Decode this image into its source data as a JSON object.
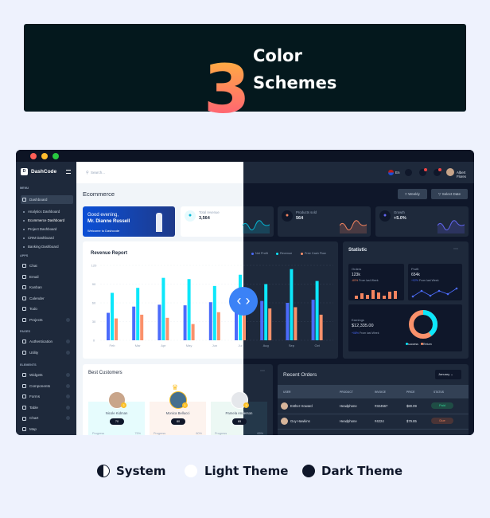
{
  "banner": {
    "number": "3",
    "line1": "Color",
    "line2": "Schemes"
  },
  "window": {
    "dots": [
      "#ff5f57",
      "#febc2e",
      "#28c840"
    ]
  },
  "sidebar": {
    "brand": "DashCode",
    "logo": "D",
    "sections": {
      "menu": "MENU",
      "apps": "APPS",
      "pages": "PAGES",
      "elements": "ELEMENTS"
    },
    "dashboard": "Dashboard",
    "sub_items": [
      "Analytics Dashboard",
      "Ecommerce Dashboard",
      "Project Dashboard",
      "CRM Dashboard",
      "Banking Dashboard"
    ],
    "apps": [
      "Chat",
      "Email",
      "Kanban",
      "Calender",
      "Todo",
      "Projects"
    ],
    "pages": [
      "Authentication",
      "Utility"
    ],
    "elements": [
      "Widgets",
      "Components",
      "Forms",
      "Table",
      "Chart",
      "Map"
    ]
  },
  "header": {
    "search_placeholder": "Search...",
    "language": "En",
    "user": "Albert Flores"
  },
  "page": {
    "title": "Ecommerce",
    "weekly": "Weekly",
    "select_date": "Select Date"
  },
  "greeting": {
    "line1": "Good evening,",
    "line2": "Mr. Dianne Russell",
    "line3": "Welcome to Dashcode"
  },
  "stats": [
    {
      "label": "Total revenue",
      "value": "3,564",
      "color": "#06b6d4"
    },
    {
      "label": "Products sold",
      "value": "564",
      "color": "#f4845f"
    },
    {
      "label": "Growth",
      "value": "+5.0%",
      "color": "#6366f1"
    }
  ],
  "revenue": {
    "title": "Revenue Report"
  },
  "chart_data": {
    "type": "bar",
    "categories": [
      "Feb",
      "Mar",
      "Apr",
      "May",
      "Jun",
      "Jul",
      "Aug",
      "Sep",
      "Oct"
    ],
    "series": [
      {
        "name": "Net Profit",
        "color": "#4b6bfb",
        "values": [
          44,
          54,
          57,
          56,
          61,
          65,
          63,
          60,
          65
        ]
      },
      {
        "name": "Revenue",
        "color": "#0ce7fa",
        "values": [
          76,
          84,
          100,
          98,
          87,
          105,
          90,
          114,
          95
        ]
      },
      {
        "name": "Free Cash Flow",
        "color": "#fa916b",
        "values": [
          35,
          41,
          36,
          26,
          45,
          44,
          51,
          53,
          41
        ]
      }
    ],
    "yticks": [
      "0",
      "30",
      "60",
      "90",
      "120"
    ],
    "ylim": [
      0,
      120
    ],
    "grid": true,
    "legend": "top-right"
  },
  "statistic": {
    "title": "Statistic",
    "orders": {
      "label": "Orders",
      "value": "123k",
      "change": "-60%",
      "note": "From last Week"
    },
    "profit": {
      "label": "Profit",
      "value": "654k",
      "change": "+02%",
      "note": "From last Week"
    },
    "earnings": {
      "label": "Earnings",
      "value": "$12,335.00",
      "change": "+08%",
      "note": "From last Week"
    },
    "donut": {
      "success": 40,
      "return": 60,
      "success_label": "success",
      "return_label": "Return"
    }
  },
  "customers": {
    "title": "Best Customers",
    "items": [
      {
        "name": "Nicole Kidman",
        "score": "70",
        "progress_label": "Progress",
        "progress": "75%",
        "rank": "2",
        "bg_light": "#e6fcfd"
      },
      {
        "name": "Monica Bellucci",
        "score": "80",
        "progress_label": "Progress",
        "progress": "80%",
        "rank": "1",
        "bg_light": "#fdf3ee"
      },
      {
        "name": "Pamela Anderson",
        "score": "65",
        "progress_label": "Progress",
        "progress": "65%",
        "rank": "3",
        "bg_light": "#ecf8f4"
      }
    ]
  },
  "orders": {
    "title": "Recent Orders",
    "month": "January",
    "columns": [
      "USER",
      "PRODUCT",
      "INVOICE",
      "PRICE",
      "STATUS"
    ],
    "rows": [
      {
        "user": "Esther Howard",
        "product": "Headphone",
        "invoice": "#324567",
        "price": "$80.09",
        "status": "Paid"
      },
      {
        "user": "Guy Hawkins",
        "product": "Headphone",
        "invoice": "#4224",
        "price": "$79.85",
        "status": "Due"
      }
    ]
  },
  "legend": {
    "system": "System",
    "light": "Light Theme",
    "dark": "Dark Theme"
  }
}
